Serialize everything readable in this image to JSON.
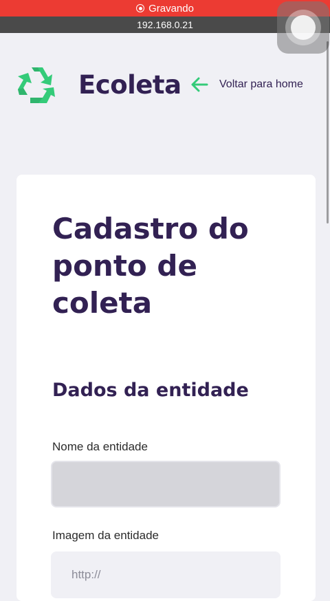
{
  "status_bar": {
    "recording_label": "Gravando",
    "url": "192.168.0.21"
  },
  "header": {
    "logo_text": "Ecoleta",
    "back_label": "Voltar para home"
  },
  "form": {
    "title": "Cadastro do ponto de coleta",
    "section_title": "Dados da entidade",
    "fields": [
      {
        "label": "Nome da entidade",
        "value": "",
        "placeholder": ""
      },
      {
        "label": "Imagem da entidade",
        "value": "",
        "placeholder": "http://"
      }
    ]
  },
  "colors": {
    "brand": "#322153",
    "accent": "#34cb79",
    "recording": "#ec3b33"
  }
}
